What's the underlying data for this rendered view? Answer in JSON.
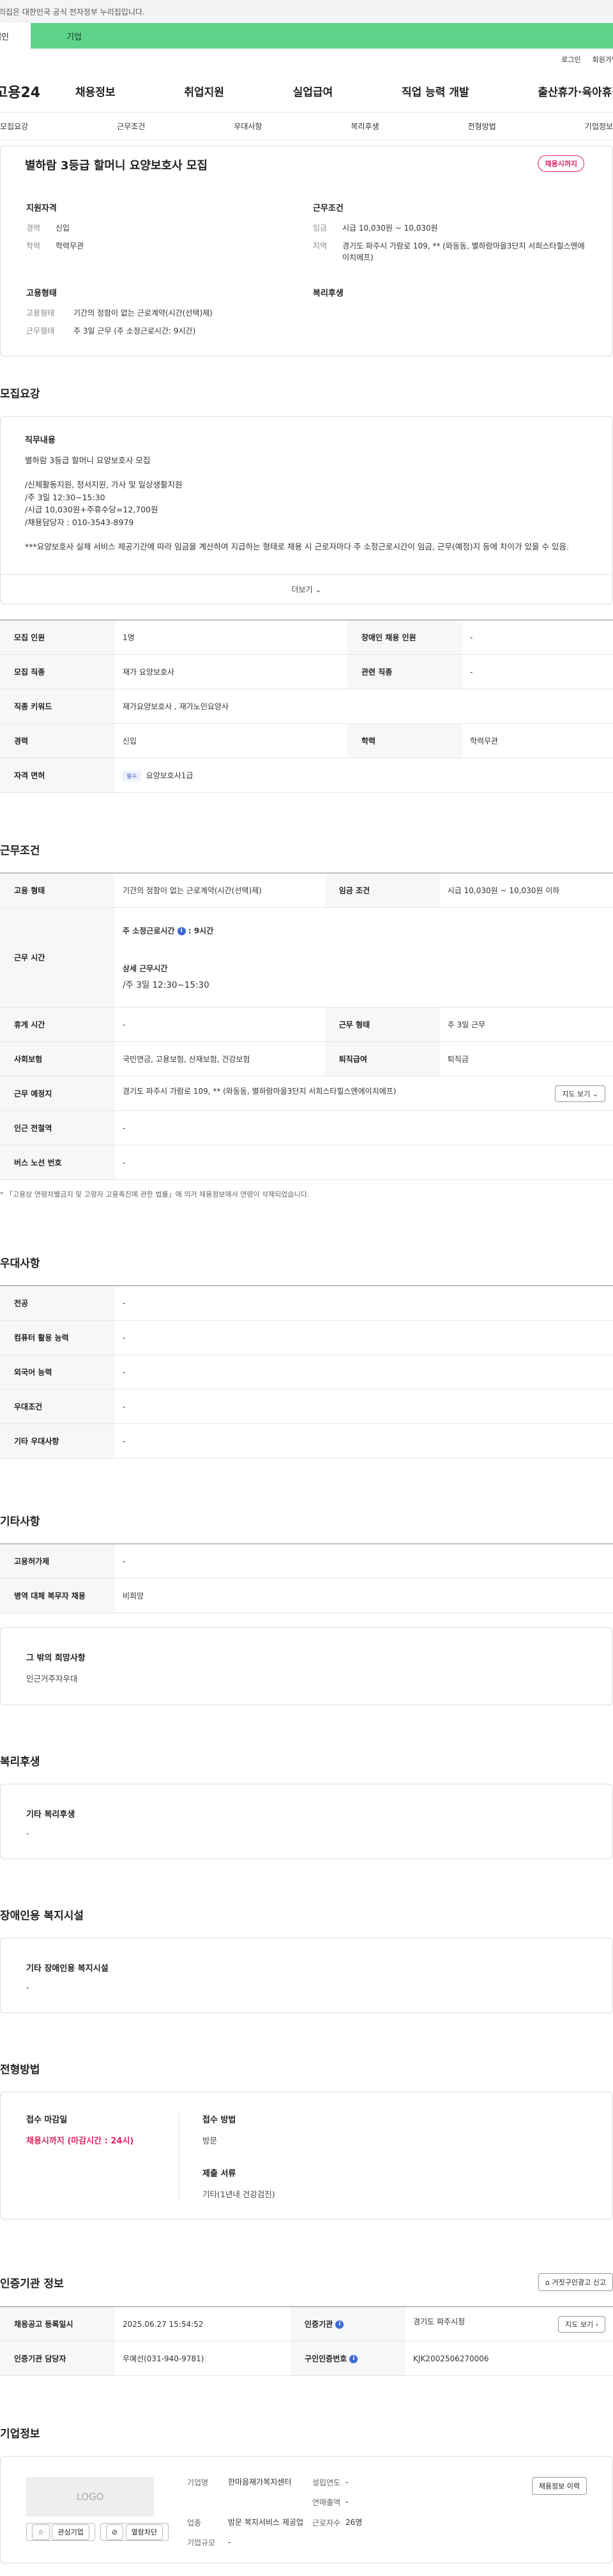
{
  "banner": {
    "text": "이 누리집은 대한민국 공식 전자정부 누리집입니다."
  },
  "usertype": {
    "personal": "개인",
    "company": "기업"
  },
  "util": {
    "login": "로그인",
    "signup": "회원가입"
  },
  "gnb": {
    "logo": "고용24",
    "menu": [
      "채용정보",
      "취업지원",
      "실업급여",
      "직업 능력 개발",
      "출산휴가·육아휴직"
    ]
  },
  "subnav": [
    "모집요강",
    "근무조건",
    "우대사항",
    "복리후생",
    "전형방법",
    "기업정보"
  ],
  "summary": {
    "title": "별하람 3등급 할머니 요양보호사 모집",
    "badge": "채용시까지",
    "qual_title": "지원자격",
    "career_k": "경력",
    "career_v": "신입",
    "edu_k": "학력",
    "edu_v": "학력무관",
    "cond_title": "근무조건",
    "wage_k": "임금",
    "wage_v": "시급 10,030원 ~ 10,030원",
    "region_k": "지역",
    "region_v": "경기도 파주시 가람로 109, ** (와동동, 별하람마을3단지 서희스타힐스엔에이치에프)",
    "emp_title": "고용형태",
    "emptype_k": "고용형태",
    "emptype_v": "기간의 정함이 없는 근로계약(시간(선택)제)",
    "worktype_k": "근무형태",
    "worktype_v": "주 3일 근무 (주 소정근로시간: 9시간)",
    "welfare_title": "복리후생"
  },
  "recruit": {
    "section_title": "모집요강",
    "desc_title": "직무내용",
    "desc_lines": [
      "별하람 3등급 할머니 요양보호사 모집",
      "",
      "/신체활동지원, 정서지원, 가사 및 일상생활지원",
      "/주 3일  12:30~15:30",
      "/시급 10,030원+주휴수당=12,700원",
      "/채용담당자 : 010-3543-8979",
      "",
      "***요양보호사 실제 서비스 제공기간에 따라 임금을 계산하여 지급하는 형태로 채용 시 근로자마다 주 소정근로시간이 임금, 근무(예정)지 등에 차이가 있을 수 있음."
    ],
    "more": "더보기",
    "rows": {
      "count_k": "모집 인원",
      "count_v": "1명",
      "disabled_k": "장애인 채용 인원",
      "disabled_v": "-",
      "job_k": "모집 직종",
      "job_v": "재가 요양보호사",
      "related_k": "관련 직종",
      "related_v": "-",
      "keyword_k": "직종 키워드",
      "keyword_v": "재가요양보호사 , 재가노인요양사",
      "career_k": "경력",
      "career_v": "신입",
      "edu_k": "학력",
      "edu_v": "학력무관",
      "license_k": "자격 면허",
      "license_chip": "필수",
      "license_v": "요양보호사1급"
    }
  },
  "workcond": {
    "section_title": "근무조건",
    "emp_k": "고용 형태",
    "emp_v": "기간의 정함이 없는 근로계약(시간(선택)제)",
    "wage_k": "임금 조건",
    "wage_v": "시급 10,030원 ~ 10,030원 이하",
    "time_k": "근무 시간",
    "time_week": "주 소정근로시간",
    "time_week_v": ": 9시간",
    "time_detail": "상세 근무시간",
    "time_detail_v": "/주 3일  12:30~15:30",
    "rest_k": "휴게 시간",
    "rest_v": "-",
    "shift_k": "근무 형태",
    "shift_v": "주 3일 근무",
    "ins_k": "사회보험",
    "ins_v": "국민연금, 고용보험, 산재보험, 건강보험",
    "retire_k": "퇴직급여",
    "retire_v": "퇴직금",
    "place_k": "근무 예정지",
    "place_v": "경기도 파주시 가람로 109, ** (와동동, 별하람마을3단지 서희스타힐스엔에이치에프)",
    "map_btn": "지도 보기",
    "subway_k": "인근 전철역",
    "subway_v": "-",
    "bus_k": "버스 노선 번호",
    "bus_v": "-",
    "note": "* 「고용상 연령차별금지 및 고령자 고용촉진에 관한 법률」에 의거 채용정보에서 연령이 삭제되었습니다."
  },
  "pref": {
    "section_title": "우대사항",
    "major_k": "전공",
    "major_v": "-",
    "pc_k": "컴퓨터 활용 능력",
    "pc_v": "-",
    "lang_k": "외국어 능력",
    "lang_v": "-",
    "cond_k": "우대조건",
    "cond_v": "-",
    "etc_k": "기타 우대사항",
    "etc_v": "-"
  },
  "etc": {
    "section_title": "기타사항",
    "insure_k": "고용허가제",
    "insure_v": "-",
    "military_k": "병역 대체 복무자 채용",
    "military_v": "비희망",
    "box_title": "그 밖의 희망사항",
    "box_v": "인근거주자우대"
  },
  "welfare": {
    "section_title": "복리후생",
    "box_title": "기타 복리후생",
    "box_v": "-"
  },
  "disabled": {
    "section_title": "장애인용 복지시설",
    "box_title": "기타 장애인용 복지시설",
    "box_v": "-"
  },
  "selection": {
    "section_title": "전형방법",
    "deadline_t": "접수 마감일",
    "deadline_v": "채용시까지 (마감시간 : 24시)",
    "method_t": "접수 방법",
    "method_v": "방문",
    "docs_t": "제출 서류",
    "docs_v": "기타(1년내 건강검진)"
  },
  "cert": {
    "section_title": "인증기관 정보",
    "report_btn": "거짓구인광고 신고",
    "reg_k": "채용공고 등록일시",
    "reg_v": "2025.06.27 15:54:52",
    "org_k": "인증기관",
    "org_v": "경기도 파주시청",
    "map_btn": "지도 보기",
    "mgr_k": "인증기관 담당자",
    "mgr_v": "우예선(031-940-9781)",
    "num_k": "구인인증번호",
    "num_v": "KJK2002506270006"
  },
  "company": {
    "section_title": "기업정보",
    "logo": "LOGO",
    "fav_btn": "관심기업",
    "block_btn": "열람차단",
    "name_k": "기업명",
    "name_v": "한마음재가복지센터",
    "est_k": "설립연도",
    "est_v": "-",
    "sales_k": "연매출액",
    "sales_v": "-",
    "ind_k": "업종",
    "ind_v": "방문 복지서비스 제공업",
    "emp_k": "근로자수",
    "emp_v": "26명",
    "size_k": "기업규모",
    "size_v": "-",
    "hist_btn": "채용정보 이력"
  }
}
